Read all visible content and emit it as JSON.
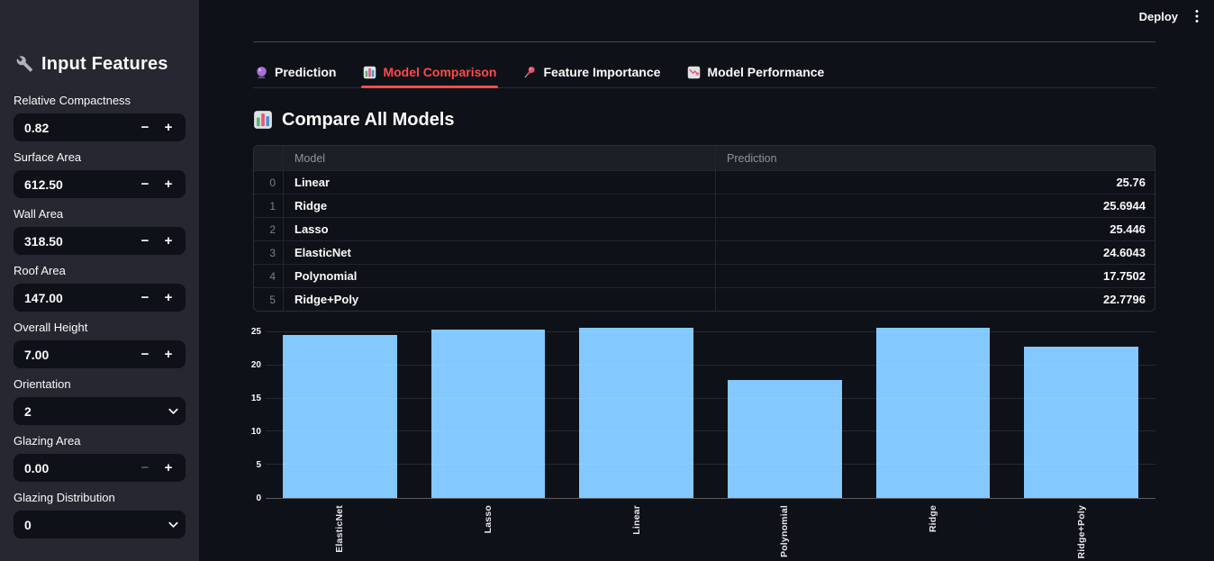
{
  "header": {
    "deploy_label": "Deploy"
  },
  "sidebar": {
    "title": "Input Features",
    "stepper_minus": "−",
    "stepper_plus": "+",
    "fields": [
      {
        "label": "Relative Compactness",
        "value": "0.82",
        "control": "number"
      },
      {
        "label": "Surface Area",
        "value": "612.50",
        "control": "number"
      },
      {
        "label": "Wall Area",
        "value": "318.50",
        "control": "number"
      },
      {
        "label": "Roof Area",
        "value": "147.00",
        "control": "number"
      },
      {
        "label": "Overall Height",
        "value": "7.00",
        "control": "number"
      },
      {
        "label": "Orientation",
        "value": "2",
        "control": "select"
      },
      {
        "label": "Glazing Area",
        "value": "0.00",
        "control": "number",
        "minus_disabled": true
      },
      {
        "label": "Glazing Distribution",
        "value": "0",
        "control": "select"
      }
    ]
  },
  "tabs": [
    {
      "label": "Prediction",
      "icon": "crystal-ball-icon",
      "active": false
    },
    {
      "label": "Model Comparison",
      "icon": "bar-chart-icon",
      "active": true
    },
    {
      "label": "Feature Importance",
      "icon": "pushpin-icon",
      "active": false
    },
    {
      "label": "Model Performance",
      "icon": "chart-decreasing-icon",
      "active": false
    }
  ],
  "section": {
    "title": "Compare All Models",
    "icon": "bar-chart-icon"
  },
  "table": {
    "columns": {
      "index": "",
      "model": "Model",
      "prediction": "Prediction"
    },
    "rows": [
      {
        "index": "0",
        "model": "Linear",
        "prediction": "25.76"
      },
      {
        "index": "1",
        "model": "Ridge",
        "prediction": "25.6944"
      },
      {
        "index": "2",
        "model": "Lasso",
        "prediction": "25.446"
      },
      {
        "index": "3",
        "model": "ElasticNet",
        "prediction": "24.6043"
      },
      {
        "index": "4",
        "model": "Polynomial",
        "prediction": "17.7502"
      },
      {
        "index": "5",
        "model": "Ridge+Poly",
        "prediction": "22.7796"
      }
    ]
  },
  "chart_data": {
    "type": "bar",
    "categories": [
      "ElasticNet",
      "Lasso",
      "Linear",
      "Polynomial",
      "Ridge",
      "Ridge+Poly"
    ],
    "values": [
      24.6043,
      25.446,
      25.76,
      17.7502,
      25.6944,
      22.7796
    ],
    "title": "",
    "xlabel": "",
    "ylabel": "",
    "yticks": [
      0,
      5,
      10,
      15,
      20,
      25
    ],
    "ylim": [
      0,
      26.1
    ],
    "grid": true,
    "legend": false,
    "bar_color": "#83c9ff"
  },
  "colors": {
    "accent": "#ff4b4b",
    "bar_blue": "#83c9ff",
    "background": "#0e1117",
    "sidebar_background": "#262730",
    "text": "#fafafa"
  }
}
